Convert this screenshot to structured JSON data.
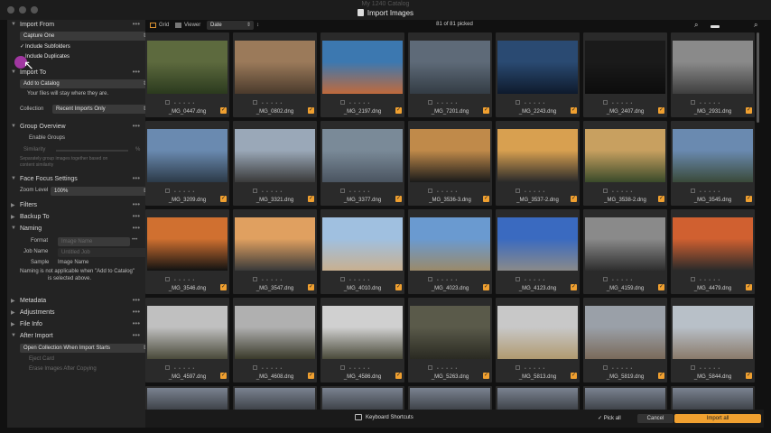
{
  "window": {
    "app_title": "My 1240 Catalog",
    "dialog_title": "Import Images"
  },
  "sidebar": {
    "import_from": {
      "title": "Import From",
      "source": "Capture One",
      "include_subfolders": "Include Subfolders",
      "include_duplicates": "Include Duplicates"
    },
    "import_to": {
      "title": "Import To",
      "destination": "Add to Catalog",
      "note": "Your files will stay where they are.",
      "collection_label": "Collection",
      "collection_value": "Recent Imports Only"
    },
    "group_overview": {
      "title": "Group Overview",
      "enable_groups": "Enable Groups",
      "similarity_label": "Similarity",
      "similarity_unit": "%",
      "similarity_note_1": "Separately group images together based on",
      "similarity_note_2": "content similarity"
    },
    "face_focus": {
      "title": "Face Focus Settings",
      "zoom_label": "Zoom Level",
      "zoom_value": "100%"
    },
    "filters": {
      "title": "Filters"
    },
    "backup_to": {
      "title": "Backup To"
    },
    "naming": {
      "title": "Naming",
      "format_label": "Format",
      "format_value": "Image Name",
      "job_name_label": "Job Name",
      "job_name_placeholder": "Untitled Job",
      "sample_label": "Sample",
      "sample_value": "Image Name",
      "note_1": "Naming is not applicable when \"Add to Catalog\"",
      "note_2": "is selected above."
    },
    "metadata": {
      "title": "Metadata"
    },
    "adjustments": {
      "title": "Adjustments"
    },
    "file_info": {
      "title": "File Info"
    },
    "after_import": {
      "title": "After Import",
      "action": "Open Collection When Import Starts",
      "option_1": "Eject Card",
      "option_2": "Erase Images After Copying"
    },
    "dots": "•••"
  },
  "toolbar": {
    "grid_label": "Grid",
    "viewer_label": "Viewer",
    "sort_value": "Date",
    "picked_text": "81 of 81 picked"
  },
  "grid": {
    "images": [
      [
        "_MG_0447.dng",
        "_MG_0802.dng",
        "_MG_2197.dng",
        "_MG_7201.dng",
        "_MG_2243.dng",
        "_MG_2407.dng",
        "_MG_2931.dng"
      ],
      [
        "_MG_3209.dng",
        "_MG_3321.dng",
        "_MG_3377.dng",
        "_MG_3536-3.dng",
        "_MG_3537-2.dng",
        "_MG_3538-2.dng",
        "_MG_3545.dng"
      ],
      [
        "_MG_3546.dng",
        "_MG_3547.dng",
        "_MG_4010.dng",
        "_MG_4023.dng",
        "_MG_4123.dng",
        "_MG_4159.dng",
        "_MG_4479.dng"
      ],
      [
        "_MG_4597.dng",
        "_MG_4608.dng",
        "_MG_4586.dng",
        "_MG_5263.dng",
        "_MG_5813.dng",
        "_MG_5819.dng",
        "_MG_5844.dng"
      ]
    ],
    "rating_dots": "• • • • •",
    "check_mark": "✓"
  },
  "bottom": {
    "keyboard_shortcuts": "Keyboard Shortcuts",
    "pick_all": "Pick all",
    "cancel": "Cancel",
    "import_all": "Import all"
  },
  "colors": {
    "accent": "#f0a030",
    "sidebar_bg": "#232323",
    "grid_bg": "#111111",
    "cell_bg": "#2a2a2a"
  }
}
